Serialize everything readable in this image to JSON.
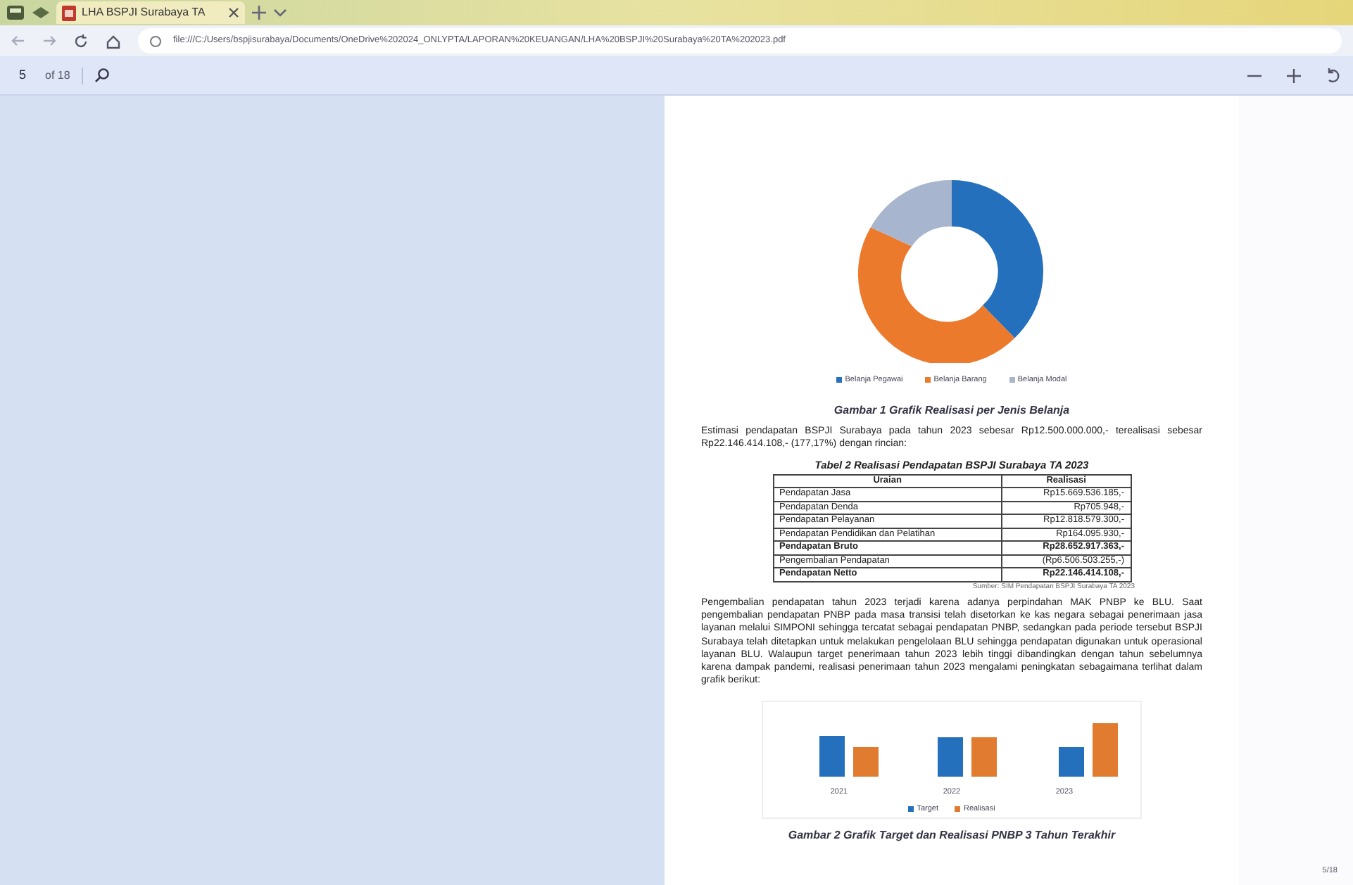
{
  "browser": {
    "tab_title": "LHA BSPJI Surabaya TA",
    "url": "file:///C:/Users/bspjisurabaya/Documents/OneDrive%202024_ONLYPTA/LAPORAN%20KEUANGAN/LHA%20BSPJI%20Surabaya%20TA%202023.pdf"
  },
  "pdf_toolbar": {
    "page": "5",
    "page_count": "of 18"
  },
  "document": {
    "donut_legend": [
      "Belanja Pegawai",
      "Belanja Barang",
      "Belanja Modal"
    ],
    "figure1_caption": "Gambar 1 Grafik Realisasi per Jenis Belanja",
    "intro": "Estimasi pendapatan BSPJI Surabaya pada tahun 2023 sebesar Rp12.500.000.000,- terealisasi sebesar Rp22.146.414.108,- (177,17%) dengan rincian:",
    "table": {
      "title": "Tabel 2 Realisasi Pendapatan BSPJI Surabaya TA 2023",
      "columns": [
        "Uraian",
        "Realisasi"
      ],
      "rows": [
        {
          "label": "Pendapatan Jasa",
          "value": "Rp15.669.536.185,-",
          "bold": false
        },
        {
          "label": "Pendapatan Denda",
          "value": "Rp705.948,-",
          "bold": false
        },
        {
          "label": "Pendapatan Pelayanan",
          "value": "Rp12.818.579.300,-",
          "bold": false
        },
        {
          "label": "Pendapatan Pendidikan dan Pelatihan",
          "value": "Rp164.095.930,-",
          "bold": false
        },
        {
          "label": "Pendapatan Bruto",
          "value": "Rp28.652.917.363,-",
          "bold": true
        },
        {
          "label": "Pengembalian Pendapatan",
          "value": "(Rp6.506.503.255,-)",
          "bold": false
        },
        {
          "label": "Pendapatan Netto",
          "value": "Rp22.146.414.108,-",
          "bold": true
        }
      ],
      "source": "Sumber: SIM Pendapatan BSPJI Surabaya TA 2023"
    },
    "paragraph": "Pengembalian pendapatan tahun 2023 terjadi karena adanya perpindahan MAK PNBP ke BLU. Saat pengembalian pendapatan PNBP pada masa transisi telah disetorkan ke kas negara sebagai penerimaan jasa layanan melalui SIMPONI sehingga tercatat sebagai pendapatan PNBP, sedangkan pada periode tersebut BSPJI Surabaya telah ditetapkan untuk melakukan pengelolaan BLU sehingga pendapatan digunakan untuk operasional layanan BLU. Walaupun target penerimaan tahun 2023 lebih tinggi dibandingkan dengan tahun sebelumnya karena dampak pandemi, realisasi penerimaan tahun 2023 mengalami peningkatan sebagaimana terlihat dalam grafik berikut:",
    "bar_x_labels": [
      "2021",
      "2022",
      "2023"
    ],
    "bar_legend": [
      "Target",
      "Realisasi"
    ],
    "figure2_caption": "Gambar 2 Grafik Target dan Realisasi PNBP 3 Tahun Terakhir",
    "page_number": "5/18"
  }
}
